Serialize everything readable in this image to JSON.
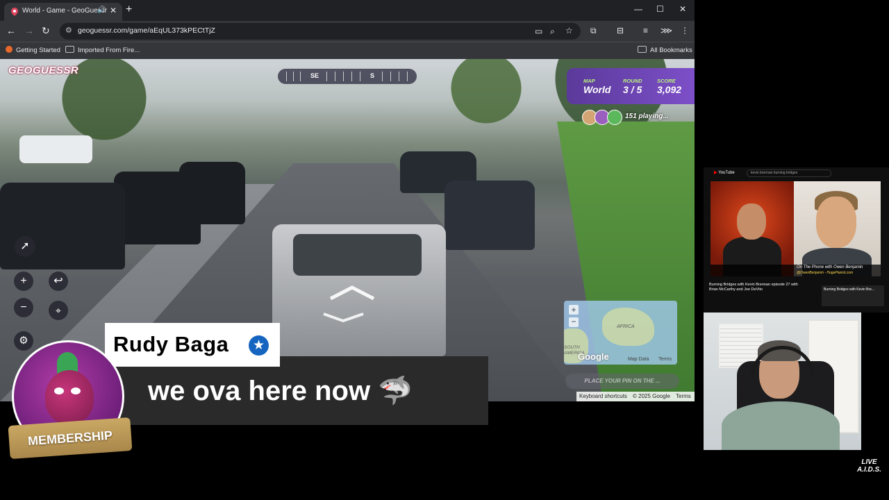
{
  "browser": {
    "tab": {
      "title": "World - Game - GeoGuessr",
      "audio_icon": "speaker-icon",
      "close": "✕"
    },
    "new_tab": "+",
    "window_controls": {
      "minimize": "—",
      "maximize": "☐",
      "close": "✕"
    },
    "url": "geoguessr.com/game/aEqUL373kPECtTjZ",
    "bookmarks": [
      {
        "label": "Getting Started"
      },
      {
        "label": "Imported From Fire..."
      }
    ],
    "all_bookmarks": "All Bookmarks"
  },
  "game": {
    "logo": "GEOGUESSR",
    "compass_labels": [
      "SE",
      "S"
    ],
    "status": {
      "map_label": "MAP",
      "map_value": "World",
      "round_label": "ROUND",
      "round_value": "3 / 5",
      "score_label": "SCORE",
      "score_value": "3,092"
    },
    "players": "151 playing...",
    "minimap": {
      "continent": "AFRICA",
      "region": "SOUTH\nAMERICA",
      "brand": "Google",
      "map_data": "Map Data",
      "terms": "Terms",
      "zoom_in": "+",
      "zoom_out": "−"
    },
    "guess_button": "PLACE YOUR PIN ON THE ...",
    "attribution": {
      "shortcuts": "Keyboard shortcuts",
      "copyright": "© 2025 Google",
      "terms": "Terms"
    },
    "controls": {
      "zoom_in": "+",
      "zoom_out": "−",
      "undo": "↩"
    }
  },
  "chat": {
    "username": "Rudy Baga",
    "message": "we ova here now 🦈",
    "badge": "MEMBERSHIP"
  },
  "youtube": {
    "logo": "YouTube",
    "search": "kevin brennan burning bridges",
    "caption": "On The Phone with Owen Benjamin",
    "caption_sub": "@OwenBenjamin - HugePianist.com",
    "video_title": "Burning Bridges with Kevin Brennan episode 27 with Brian McCarthy and Joe DeVito",
    "side_item": "Burning Bridges with Kevin Bre..."
  },
  "overlay": {
    "live_logo": "LIVE\nA.I.D.S."
  },
  "colors": {
    "geoguessr_purple": "#7d4fc8",
    "status_label": "#b8f27a",
    "verified_blue": "#1565c0",
    "membership_gold": "#c9a763"
  }
}
